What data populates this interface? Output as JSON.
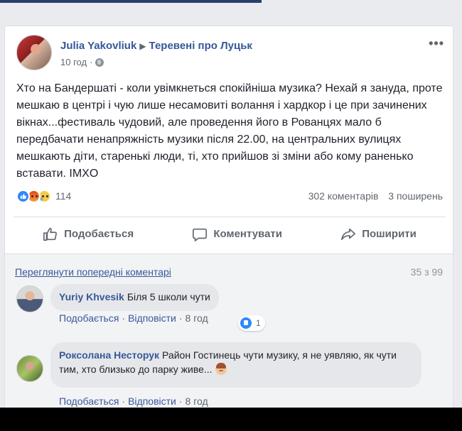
{
  "post": {
    "author": "Julia Yakovliuk",
    "group": "Теревені про Луцьк",
    "time": "10 год",
    "more": "•••",
    "text": "Хто на Бандершаті - коли увімкнеться спокійніша музика? Нехай я зануда, проте мешкаю в центрі і чую лише несамовиті волання і хардкор і це при зачинених вікнах...фестиваль чудовий, але проведення його в Рованцях мало б передбачати ненапряжність музики після 22.00, на центральних вулицях мешкають діти, старенькі люди, ті, хто прийшов зі зміни або кому раненько вставати. IMXO",
    "reaction_count": "114",
    "comments_count": "302 коментарів",
    "shares_count": "3 поширень"
  },
  "actions": {
    "like": "Подобається",
    "comment": "Коментувати",
    "share": "Поширити"
  },
  "comments_section": {
    "view_previous": "Переглянути попередні коментарі",
    "counter": "35 з 99",
    "items": [
      {
        "author": "Yuriy Khvesik",
        "text": "Біля 5 школи чути",
        "likes": "1",
        "like_label": "Подобається",
        "reply_label": "Відповісти",
        "time": "8 год"
      },
      {
        "author": "Роксолана Несторук",
        "text": "Район Гостинець чути музику, я не уявляю, як чути тим, хто близько до парку живе...",
        "like_label": "Подобається",
        "reply_label": "Відповісти",
        "time": "8 год"
      }
    ]
  },
  "colors": {
    "link": "#365899",
    "background": "#e9ebee",
    "like_blue": "#2d88ff"
  }
}
